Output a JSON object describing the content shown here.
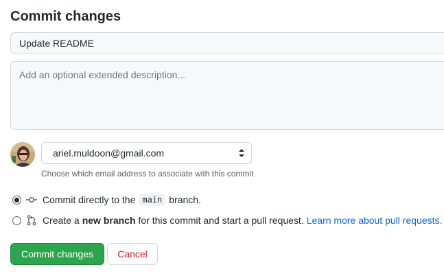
{
  "header": {
    "title": "Commit changes"
  },
  "commit": {
    "summary_value": "Update README",
    "description_placeholder": "Add an optional extended description..."
  },
  "author": {
    "avatar_icon": "user-avatar",
    "email": "ariel.muldoon@gmail.com",
    "email_hint": "Choose which email address to associate with this commit"
  },
  "options": {
    "direct": {
      "selected": true,
      "icon": "git-commit-icon",
      "prefix": "Commit directly to the",
      "branch": "main",
      "suffix": "branch."
    },
    "new_branch": {
      "selected": false,
      "icon": "git-pull-request-icon",
      "prefix": "Create a",
      "bold": "new branch",
      "suffix": "for this commit and start a pull request.",
      "link": "Learn more about pull requests."
    }
  },
  "actions": {
    "commit_label": "Commit changes",
    "cancel_label": "Cancel"
  },
  "colors": {
    "primary": "#2da44e",
    "danger": "#cf222e",
    "link": "#0969da"
  }
}
